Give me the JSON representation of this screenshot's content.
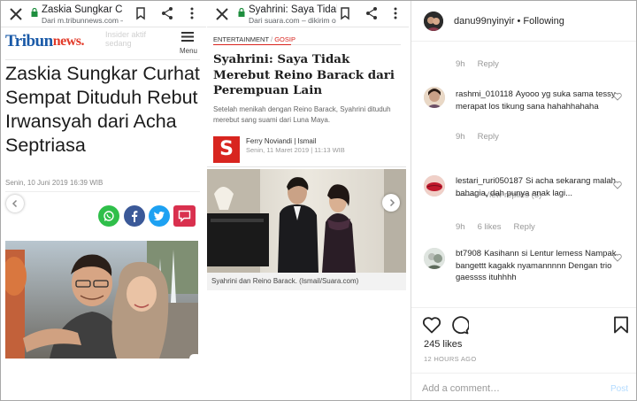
{
  "tribun": {
    "tab_title": "Zaskia Sungkar C...",
    "tab_url": "Dari m.tribunnews.com – d",
    "logo_part1": "Tribun",
    "logo_part2": "news.",
    "ghost_text": "Insider aktif sedang",
    "menu_label": "Menu",
    "headline": "Zaskia Sungkar Curhat Sempat Dituduh Rebut Irwansyah dari Acha Septriasa",
    "date": "Senin, 10 Juni 2019 16:39 WIB",
    "share_colors": {
      "whatsapp": "#2fbf4a",
      "facebook": "#3b5998",
      "twitter": "#1da1f2",
      "comment": "#d9304e"
    }
  },
  "suara": {
    "tab_title": "Syahrini: Saya Tidak...",
    "tab_url": "Dari suara.com – dikirim o",
    "kicker": "ENTERTAINMENT",
    "kicker_sep": " / ",
    "kicker_sub": "GOSIP",
    "headline": "Syahrini: Saya Tidak Merebut Reino Barack dari Perempuan Lain",
    "lead": "Setelah menikah dengan Reino Barack, Syahrini dituduh merebut sang suami dari Luna Maya.",
    "avatar_letter": "S",
    "author": "Ferry Noviandi | Ismail",
    "time": "Senin, 11 Maret 2019 | 11:13 WIB",
    "caption": "Syahrini dan Reino Barack. (Ismail/Suara.com)",
    "accent": "#d8251f"
  },
  "instagram": {
    "header_user": "danu99nyinyir",
    "header_dot": "•",
    "header_status": "Following",
    "comments": [
      {
        "meta_time": "9h",
        "meta_likes": "",
        "reply": "Reply"
      },
      {
        "username": "rashmi_010118",
        "text": "Ayooo yg suka sama tessy merapat los tikung sana hahahhahaha",
        "time": "9h",
        "likes": "",
        "reply": "Reply",
        "view_replies": "View replies (3)"
      },
      {
        "username": "lestari_ruri050187",
        "text": "Si acha sekarang malah bahagia, dah punya anak lagi...",
        "time": "9h",
        "likes": "6 likes",
        "reply": "Reply"
      },
      {
        "username": "bt7908",
        "text": "Kasihann si Lentur lemess Nampak bangettt kagakk nyamannnnn Dengan trio gaessss ituhhhh"
      }
    ],
    "likes": "245 likes",
    "time": "12 HOURS AGO",
    "comment_placeholder": "Add a comment…",
    "post_label": "Post"
  }
}
